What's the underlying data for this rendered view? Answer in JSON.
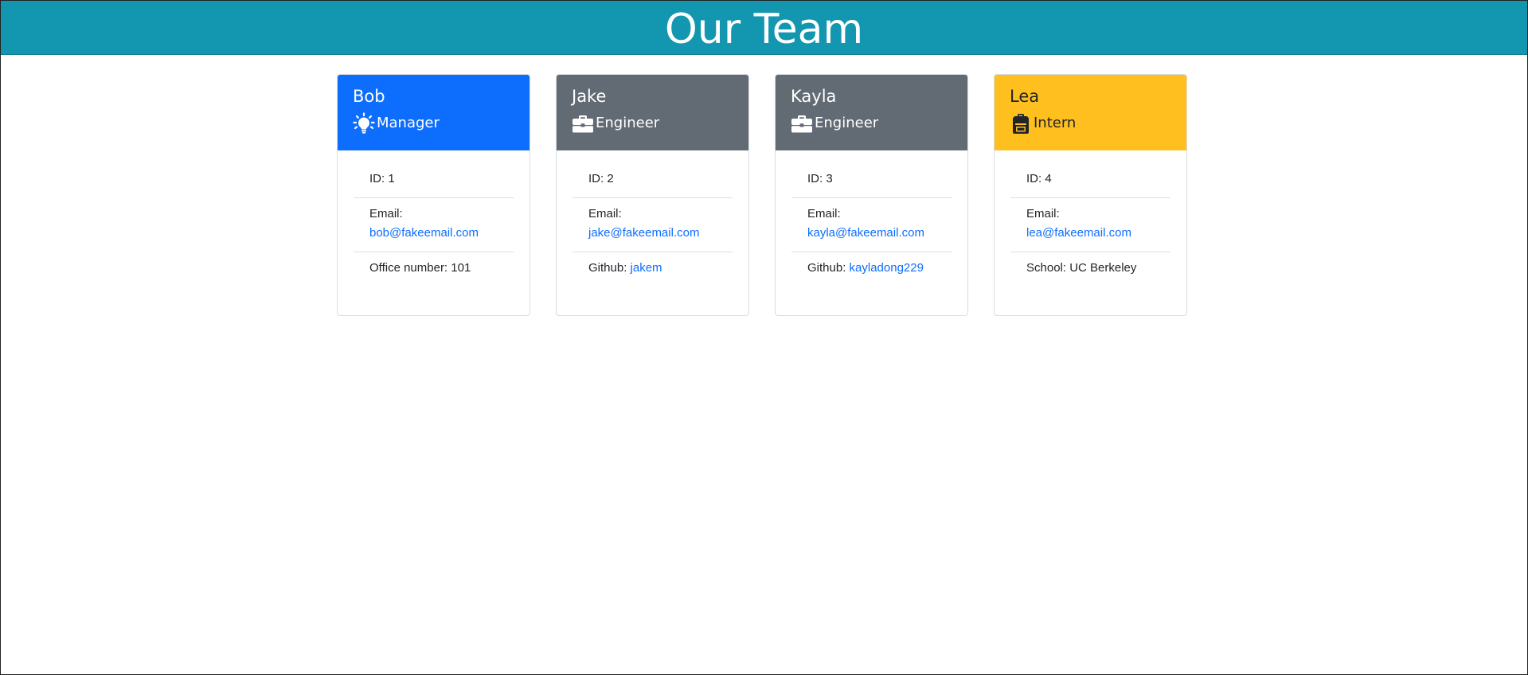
{
  "page": {
    "title": "Our Team"
  },
  "colors": {
    "header": "#1396b0",
    "manager": "#0d6efd",
    "engineer": "#626a73",
    "intern": "#ffc01f",
    "link": "#0d6efd"
  },
  "team": [
    {
      "name": "Bob",
      "role": "Manager",
      "role_icon": "lightbulb-icon",
      "id_text": "ID: 1",
      "email_label": "Email:",
      "email": "bob@fakeemail.com",
      "extra_label": "Office number: ",
      "extra_value": "101"
    },
    {
      "name": "Jake",
      "role": "Engineer",
      "role_icon": "briefcase-icon",
      "id_text": "ID: 2",
      "email_label": "Email:",
      "email": "jake@fakeemail.com",
      "extra_label": "Github: ",
      "extra_value": "jakem"
    },
    {
      "name": "Kayla",
      "role": "Engineer",
      "role_icon": "briefcase-icon",
      "id_text": "ID: 3",
      "email_label": "Email:",
      "email": "kayla@fakeemail.com",
      "extra_label": "Github: ",
      "extra_value": "kayladong229"
    },
    {
      "name": "Lea",
      "role": "Intern",
      "role_icon": "backpack-icon",
      "id_text": "ID: 4",
      "email_label": "Email:",
      "email": "lea@fakeemail.com",
      "extra_label": "School: ",
      "extra_value": "UC Berkeley"
    }
  ]
}
